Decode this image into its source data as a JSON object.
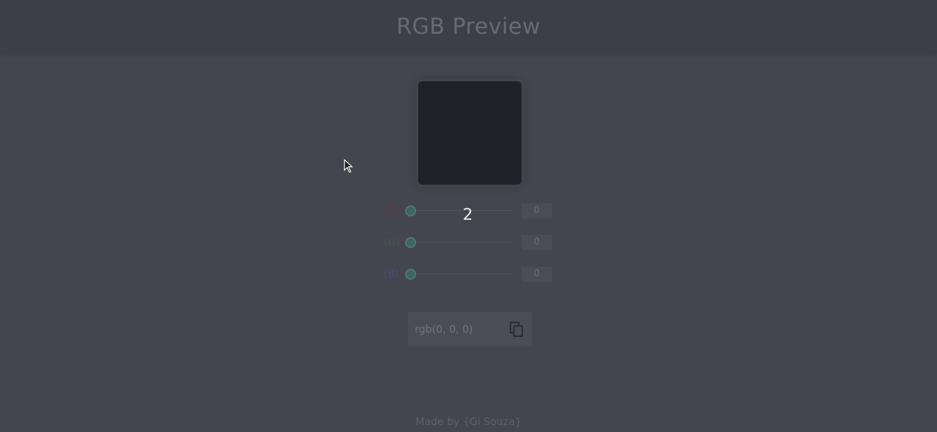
{
  "header": {
    "title": "RGB Preview"
  },
  "preview": {
    "color": "#202229"
  },
  "sliders": [
    {
      "label": "(R)",
      "value": "0",
      "color": "#6b3a3e"
    },
    {
      "label": "(G)",
      "value": "0",
      "color": "#3f5a4b"
    },
    {
      "label": "(B)",
      "value": "0",
      "color": "#4a4a7a"
    }
  ],
  "overlay": {
    "number": "2"
  },
  "output": {
    "text": "rgb(0, 0, 0)",
    "copy_icon": "copy-icon"
  },
  "footer": {
    "text": "Made by {Gi Souza}"
  }
}
